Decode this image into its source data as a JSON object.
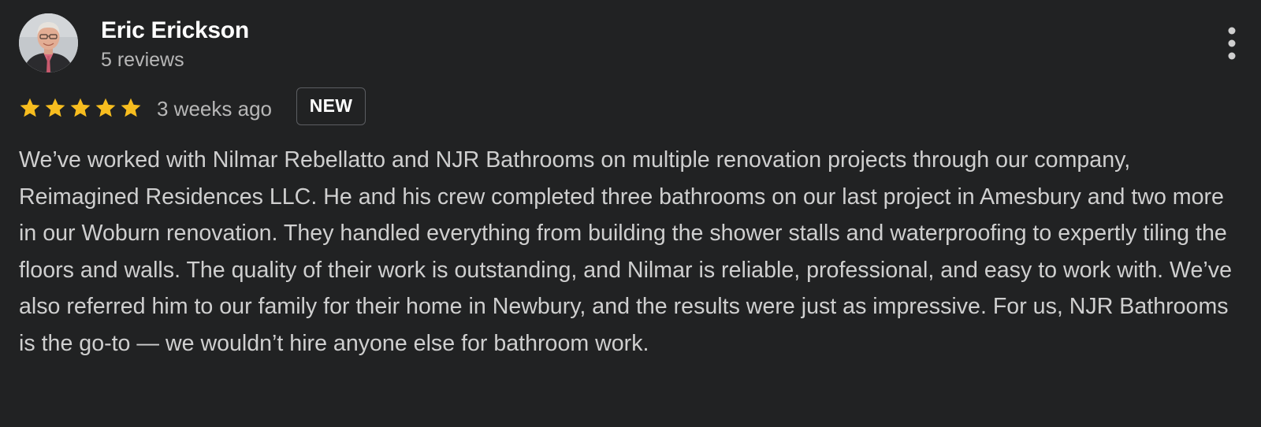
{
  "review": {
    "author_name": "Eric Erickson",
    "author_meta": "5 reviews",
    "rating": 5,
    "rating_max": 5,
    "date": "3 weeks ago",
    "badge": "NEW",
    "text": "We’ve worked with Nilmar Rebellatto and NJR Bathrooms on multiple renovation projects through our company, Reimagined Residences LLC. He and his crew completed three bathrooms on our last project in Amesbury and two more in our Woburn renovation. They handled everything from building the shower stalls and waterproofing to expertly tiling the floors and walls. The quality of their work is outstanding, and Nilmar is reliable, professional, and easy to work with. We’ve also referred him to our family for their home in Newbury, and the results were just as impressive. For us, NJR Bathrooms is the go-to — we wouldn’t hire anyone else for bathroom work.",
    "icons": {
      "avatar": "user-photo",
      "more": "more-vertical-icon",
      "star": "star-icon"
    },
    "colors": {
      "background": "#212223",
      "star": "#f7bd1f",
      "author": "#ffffff",
      "secondary_text": "#b7b7b7",
      "body_text": "#cfcfcf",
      "badge_border": "#5c5e62"
    }
  }
}
